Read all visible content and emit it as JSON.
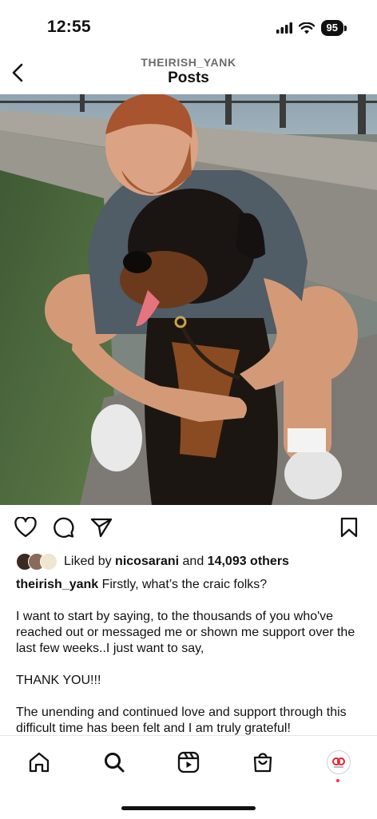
{
  "status": {
    "time": "12:55",
    "battery": "95"
  },
  "header": {
    "username": "THEIRISH_YANK",
    "title": "Posts"
  },
  "post": {
    "image_alt": "Man hugging a rottweiler dog sitting by a waterfront railing",
    "likes_prefix": "Liked by ",
    "liked_by": "nicosarani",
    "likes_mid": " and ",
    "likes_count": "14,093 others",
    "caption_user": "theirish_yank",
    "caption_first": " Firstly, what’s the craic folks?",
    "paragraphs": [
      "I want to start by saying, to the thousands of you who've reached out or messaged me or shown me support over the last few weeks..I just want to say,",
      "THANK YOU!!!",
      "The unending and continued love and support through this difficult time has been felt and I am truly grateful!"
    ]
  },
  "icons": {
    "actions": [
      "heart-icon",
      "comment-icon",
      "share-icon",
      "bookmark-icon"
    ],
    "nav": [
      "home-icon",
      "search-icon",
      "reels-icon",
      "shop-icon",
      "profile-avatar"
    ]
  },
  "colors": {
    "notification_dot": "#ff3040",
    "muted_text": "#6b6b6b"
  }
}
